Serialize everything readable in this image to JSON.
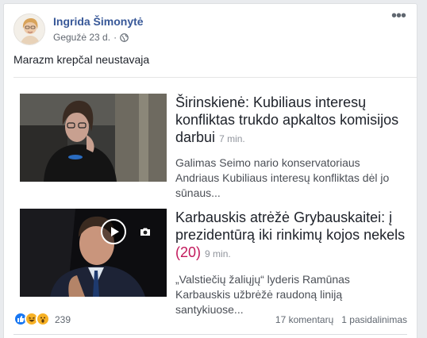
{
  "post": {
    "author": "Ingrida Šimonytė",
    "date": "Gegužė 23 d.",
    "date_separator": "·",
    "privacy_icon": "globe-icon",
    "menu_icon": "more-horiz-icon",
    "text": "Marazm krepčal neustavaja"
  },
  "items": [
    {
      "title": "Širinskienė: Kubiliaus interesų konfliktas trukdo apkaltos komisijos darbui",
      "ago": "7 min.",
      "comment_count": "",
      "description": "Galimas Seimo nario konservatoriaus Andriaus Kubiliaus interesų konfliktas dėl jo sūnaus..."
    },
    {
      "title": "Karbauskis atrėžė Grybauskaitei: į prezidentūrą iki rinkimų kojos nekels",
      "ago": "9 min.",
      "comment_count": "(20)",
      "description": "„Valstiečių žaliųjų“ lyderis Ramūnas Karbauskis užbrėžė raudoną liniją santykiuose..."
    }
  ],
  "reactions": {
    "icons": [
      "like-icon",
      "haha-icon",
      "wow-icon"
    ],
    "count": "239",
    "comments": "17 komentarų",
    "shares": "1 pasidalinimas",
    "colors": {
      "like": "#1877f2",
      "haha": "#f7b125",
      "wow": "#f7b125"
    }
  }
}
